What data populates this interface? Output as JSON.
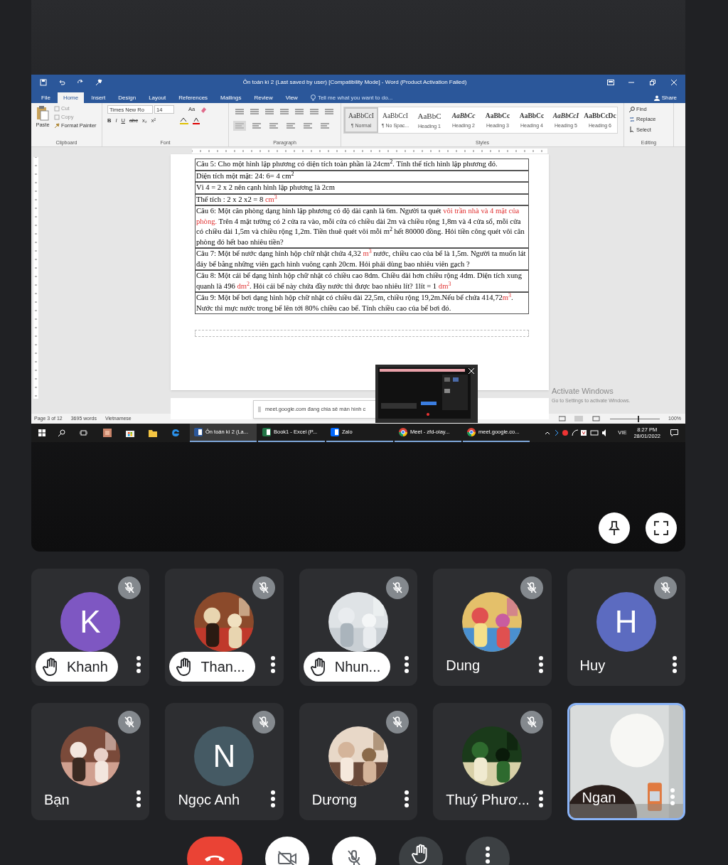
{
  "shared_screen": {
    "word": {
      "title": "Ôn toán kì 2 (Last saved by user) [Compatibility Mode] - Word (Product Activation Failed)",
      "tabs": [
        {
          "label": "File",
          "selected": false
        },
        {
          "label": "Home",
          "selected": true
        },
        {
          "label": "Insert",
          "selected": false
        },
        {
          "label": "Design",
          "selected": false
        },
        {
          "label": "Layout",
          "selected": false
        },
        {
          "label": "References",
          "selected": false
        },
        {
          "label": "Mailings",
          "selected": false
        },
        {
          "label": "Review",
          "selected": false
        },
        {
          "label": "View",
          "selected": false
        }
      ],
      "tell_me": "Tell me what you want to do...",
      "share": "Share",
      "clipboard": {
        "paste": "Paste",
        "cut": "Cut",
        "copy": "Copy",
        "format_painter": "Format Painter",
        "label": "Clipboard"
      },
      "font": {
        "name": "Times New Ro",
        "size": "14",
        "case": "Aa",
        "buttons": [
          "B",
          "I",
          "U",
          "abc",
          "x₂",
          "x²"
        ],
        "label": "Font"
      },
      "paragraph": {
        "label": "Paragraph"
      },
      "styles": {
        "label": "Styles",
        "items": [
          {
            "preview": "AaBbCcI",
            "name": "¶ Normal",
            "selected": true
          },
          {
            "preview": "AaBbCcI",
            "name": "¶ No Spac...",
            "selected": false
          },
          {
            "preview": "AaBbC",
            "name": "Heading 1",
            "selected": false
          },
          {
            "preview": "AaBbCc",
            "name": "Heading 2",
            "selected": false
          },
          {
            "preview": "AaBbCc",
            "name": "Heading 3",
            "selected": false
          },
          {
            "preview": "AaBbCc",
            "name": "Heading 4",
            "selected": false
          },
          {
            "preview": "AaBbCcI",
            "name": "Heading 5",
            "selected": false
          },
          {
            "preview": "AaBbCcDc",
            "name": "Heading 6",
            "selected": false
          }
        ]
      },
      "editing": {
        "label": "Editing",
        "items": [
          "Find",
          "Replace",
          "Select"
        ]
      },
      "document_rows": [
        [
          {
            "text": "Câu 5: Cho một hình lập phương có diện tích toàn phần là 24cm$^{2}$. Tính thể tích hình lập phương đó.",
            "red": false
          }
        ],
        [
          {
            "text": "Diện tích một mặt: 24: 6= 4 cm$^{2}$",
            "red": false
          }
        ],
        [
          {
            "text": "Vì 4 = 2 x 2 nên cạnh hình lập phương là 2cm",
            "red": false
          }
        ],
        [
          {
            "text": "Thể tích : 2 x 2 x2 = 8 ",
            "red": false
          },
          {
            "text": "cm$^{3}$",
            "red": true
          }
        ],
        [
          {
            "text": "Câu 6: Một căn phòng dạng hình lập phương có độ dài cạnh là 6m. Người ta quét ",
            "red": false
          },
          {
            "text": "vôi trần nhà và 4 mặt của phòng.",
            "red": true
          },
          {
            "text": " Trên 4 mặt tường có 2 cửa ra vào, mỗi cửa có chiều dài 2m và chiều rộng 1,8m và 4 cửa sổ, mỗi cửa có chiều dài 1,5m và chiều rộng 1,2m. Tiền thuê quét vôi mỗi m$^{2}$ hết 80000 đồng. Hỏi tiền công quét vôi căn phòng đó hết bao nhiêu tiền?",
            "red": false
          }
        ],
        [
          {
            "text": "Câu 7: Một bể nước dạng hình hộp chữ nhật chứa 4,32 ",
            "red": false
          },
          {
            "text": "m$^{3}$",
            "red": true
          },
          {
            "text": " nước, chiều cao của bể là 1,5m. Người ta muốn lát đáy bể bằng những viên gạch hình vuông cạnh 20cm. Hỏi phải dùng bao nhiêu viên gạch ?",
            "red": false
          }
        ],
        [
          {
            "text": "Câu 8: Một cái bể dạng hình hộp chữ nhật có chiều cao 8dm. Chiều dài hơn chiều rộng 4dm. Diện tích xung quanh là 496 ",
            "red": false
          },
          {
            "text": "dm$^{2}$",
            "red": true
          },
          {
            "text": ". Hỏi cái bể này chứa đầy nước thì được bao nhiêu lít? 1lít = 1 ",
            "red": false
          },
          {
            "text": "dm$^{3}$",
            "red": true
          }
        ],
        [
          {
            "text": "Câu 9: Một bể bơi dạng hình hộp chữ nhật có chiều dài 22,5m, chiều rộng 19,2m.Nếu bể chứa 414,72",
            "red": false
          },
          {
            "text": "m$^{3}$",
            "red": true
          },
          {
            "text": ". Nước thì mực nước trong bể lên tới 80% chiều cao bể. Tính chiều cao của bể bơi đó.",
            "red": false
          }
        ]
      ],
      "sharing_notice": "meet.google.com đang chia sẻ màn hình c",
      "activation": [
        "Activate Windows",
        "Go to Settings to activate Windows."
      ],
      "status_bar": {
        "page": "Page 3 of 12",
        "words": "3695 words",
        "language": "Vietnamese",
        "zoom": "100%",
        "zoom_slider": {
          "level": 0.55
        }
      }
    },
    "taskbar": {
      "apps": [
        {
          "kind": "word",
          "label": "Ôn toán kì 2 (La...",
          "active": true
        },
        {
          "kind": "excel",
          "label": "Book1 - Excel (P...",
          "active": false
        },
        {
          "kind": "zalo",
          "label": "Zalo",
          "active": false
        },
        {
          "kind": "chrome",
          "label": "Meet - zfd-oiay...",
          "active": false
        },
        {
          "kind": "chrome",
          "label": "meet.google.co...",
          "active": false
        }
      ],
      "language": "VIE",
      "time": "8:27 PM",
      "date": "28/01/2022"
    }
  },
  "participants": [
    {
      "name": "Khanh",
      "kind": "letter",
      "letter": "K",
      "color": "#7e57c2",
      "hand_raised": true,
      "selected": false
    },
    {
      "name": "Than...",
      "kind": "picture",
      "hand_raised": true,
      "selected": false
    },
    {
      "name": "Nhun...",
      "kind": "picture",
      "hand_raised": true,
      "selected": false
    },
    {
      "name": "Dung",
      "kind": "picture",
      "hand_raised": false,
      "selected": false
    },
    {
      "name": "Huy",
      "kind": "letter",
      "letter": "H",
      "color": "#5c6bc0",
      "hand_raised": false,
      "selected": false
    },
    {
      "name": "Bạn",
      "kind": "picture",
      "hand_raised": false,
      "selected": false
    },
    {
      "name": "Ngọc Anh",
      "kind": "letter",
      "letter": "N",
      "color": "#455a64",
      "hand_raised": false,
      "selected": false
    },
    {
      "name": "Dương",
      "kind": "picture",
      "hand_raised": false,
      "selected": false
    },
    {
      "name": "Thuý Phươ...",
      "kind": "picture",
      "hand_raised": false,
      "selected": false
    },
    {
      "name": "Ngan",
      "kind": "video",
      "hand_raised": false,
      "selected": true
    }
  ],
  "controls": [
    {
      "kind": "end"
    },
    {
      "kind": "camera"
    },
    {
      "kind": "mic"
    },
    {
      "kind": "hand"
    },
    {
      "kind": "more"
    }
  ]
}
